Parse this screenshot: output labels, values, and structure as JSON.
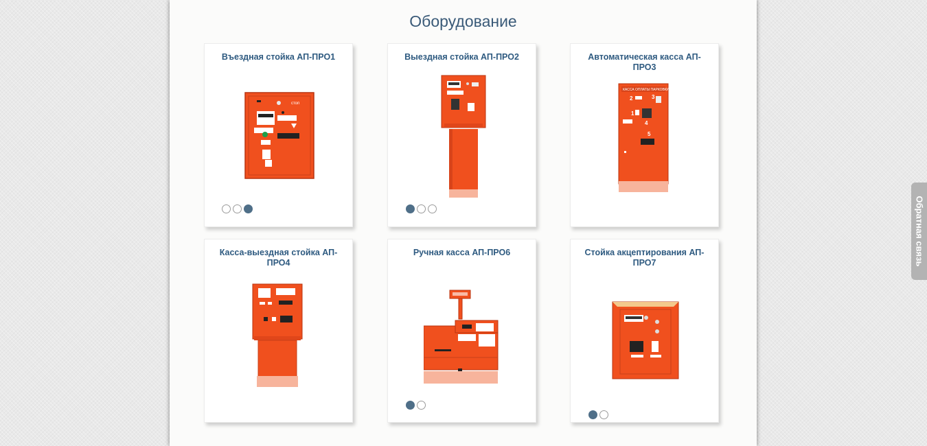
{
  "section": {
    "title": "Оборудование"
  },
  "products": [
    {
      "title": "Въездная стойка АП-ПРО1",
      "slides": 3,
      "active_slide": 3
    },
    {
      "title": "Выездная стойка АП-ПРО2",
      "slides": 3,
      "active_slide": 1
    },
    {
      "title": "Автоматическая касса АП-ПРО3",
      "slides": 0,
      "active_slide": 0
    },
    {
      "title": "Касса-выездная стойка АП-ПРО4",
      "slides": 0,
      "active_slide": 0
    },
    {
      "title": "Ручная касса АП-ПРО6",
      "slides": 2,
      "active_slide": 1
    },
    {
      "title": "Стойка акцептирования АП-ПРО7",
      "slides": 2,
      "active_slide": 1
    }
  ],
  "feedback": {
    "label": "Обратная связь"
  },
  "colors": {
    "accent": "#3a5a78",
    "card_title": "#2e5a80",
    "device_orange": "#f0501e",
    "dot_active": "#4f6f88"
  }
}
